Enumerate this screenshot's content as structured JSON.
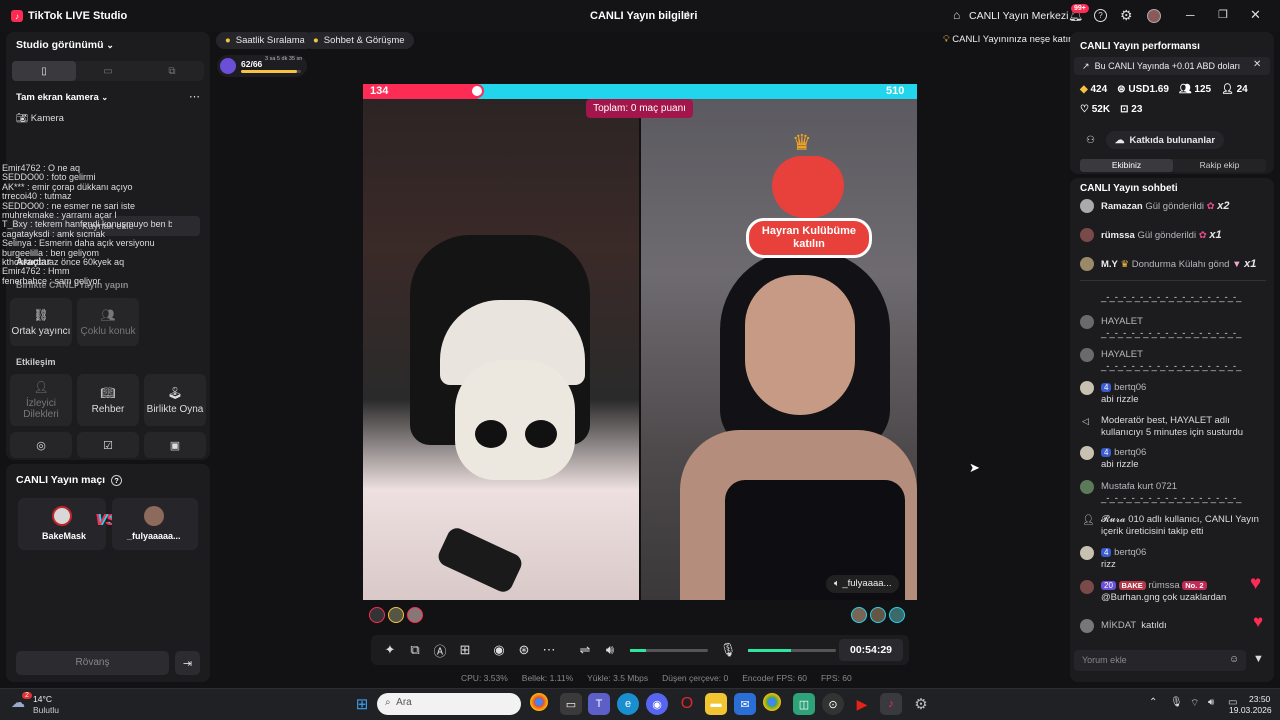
{
  "app": {
    "title": "TikTok LIVE Studio",
    "center_title": "CANLI Yayın bilgileri",
    "live_center": "CANLI Yayın Merkezi",
    "notif_count": "99+"
  },
  "left": {
    "studio_view": "Studio görünümü",
    "camera_section": "Tam ekran kamera",
    "camera_item": "Kamera",
    "overlay_chat": [
      "Emir4762 : O ne aq",
      "SEDDO00 : foto gelirmi",
      "AK*** : emir çorap dükkanı açıyo",
      "trrecoi40 : tutmaz",
      "SEDDO00 : ne esmer ne sari iste",
      "muhrekmake : yarramı açar l",
      "T_Bxy : tekrem hanfendi konuşmuyo ben bıraktırdım ben t bak",
      "cagatayksdi : amk sıcmak",
      "Selinya : Esmerin daha açık versiyonu",
      "burgeelilla : ben geliyom",
      "kthonkurtt : az önce 60kyek aq",
      "Emir4762 : Hmm",
      "fenerbahce : sam geliyor"
    ],
    "ghost_label1": "Kaynak ekle",
    "tools": "Araçlar",
    "together": "Birlikte CANLI Yayın yapın",
    "cohost": "Ortak yayıncı",
    "multi_guest": "Çoklu konuk",
    "interaction": "Etkileşim",
    "viewer_requests": "İzleyici Dilekleri",
    "guide": "Rehber",
    "play_together": "Birlikte Oyna",
    "match_title": "CANLI Yayın maçı",
    "player1": "BakeMask",
    "player2": "_fulyaaaaa...",
    "rematch": "Rövanş"
  },
  "top_chips": {
    "hourly": "Saatlik Sıralama",
    "chat_meet": "Sohbet & Görüşme",
    "progress": "62/66",
    "progress_time": "3 sa 5 dk 35 sn",
    "cheer": "CANLI Yayınınıza neşe katın"
  },
  "battle": {
    "left_score": "134",
    "right_score": "510",
    "total": "Toplam: 0 maç puanı",
    "fan_club": "Hayran Kulübüme katılın",
    "right_name": "_fulyaaaa...",
    "left_score_ratio": 0.208
  },
  "controls": {
    "timer": "00:54:29"
  },
  "stats": {
    "cpu": "CPU: 3.53%",
    "mem": "Bellek: 1.11%",
    "upload": "Yükle: 3.5 Mbps",
    "dropped": "Düşen çerçeve: 0",
    "encoder_fps": "Encoder FPS: 60",
    "fps": "FPS: 60"
  },
  "right": {
    "performance": "CANLI Yayın performansı",
    "banner": "Bu CANLI Yayında +0.01 ABD doları",
    "s1": "424",
    "s2": "USD1.69",
    "s3": "125",
    "s4": "24",
    "s5": "52K",
    "s6": "23",
    "contributors": "Katkıda bulunanlar",
    "tab1": "Ekibiniz",
    "tab2": "Rakip ekip",
    "chat_title": "CANLI Yayın sohbeti",
    "g1_name": "Ramazan",
    "g1_text": "Gül gönderildi",
    "g1_mult": "x2",
    "g2_name": "rümssa",
    "g2_text": "Gül gönderildi",
    "g2_mult": "x1",
    "g3_name": "M.Y",
    "g3_text": "Dondurma Külahı gönd",
    "g3_mult": "x1",
    "dash": "_-_-_-_-_-_-_-_-_-_-_-_-_-_-_-_-_",
    "c_hayalet": "HAYALET",
    "c_lvl": "4",
    "c_bertq": "bertq06",
    "c_abi": "abi rizzle",
    "c_mod": "Moderatör best, HAYALET adlı kullanıcıyı 5 minutes için susturdu",
    "c_mustafa": "Mustafa kurt 0721",
    "c_follow": "𝓡𝓾𝓻𝓪 010  adlı kullanıcı, CANLI Yayın içerik üreticisini takip etti",
    "c_rizz": "rizz",
    "c_lv20": "20",
    "c_bake": "BAKE",
    "c_rumssa": "rümssa",
    "c_no2": "No. 2",
    "c_burhan": "@Burhan.gng çok uzaklardan",
    "c_mikdat": "MİKDAT",
    "c_joined": "katıldı",
    "comment_placeholder": "Yorum ekle"
  },
  "taskbar": {
    "temp": "14°C",
    "weather": "Bulutlu",
    "weather_badge": "2",
    "search": "Ara",
    "time": "23:50",
    "date": "19.03.2026"
  },
  "colors": {
    "accent": "#fe2c55",
    "teal": "#20d5ec",
    "green": "#2ee59d"
  }
}
